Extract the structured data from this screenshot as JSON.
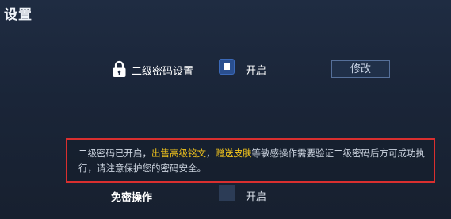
{
  "header": {
    "title": "设置"
  },
  "secondary_password": {
    "label": "二级密码设置",
    "icon": "lock-icon",
    "checkbox_label": "开启",
    "checked": true,
    "modify_button_label": "修改"
  },
  "notice": {
    "text_1": "二级密码已开启，",
    "highlight_1": "出售高级铭文",
    "text_2": "，",
    "highlight_2": "赠送皮肤",
    "text_3": "等敏感操作需要验证二级密码后方可成功执行，请注意保护您的密码安全。",
    "highlight_color": "#f0c31d",
    "border_color": "#d92f2f"
  },
  "free_operation": {
    "label": "免密操作",
    "checkbox_label": "开启",
    "checked": false
  },
  "colors": {
    "background": "#1a2538",
    "accent_blue": "#2a4f8f"
  }
}
